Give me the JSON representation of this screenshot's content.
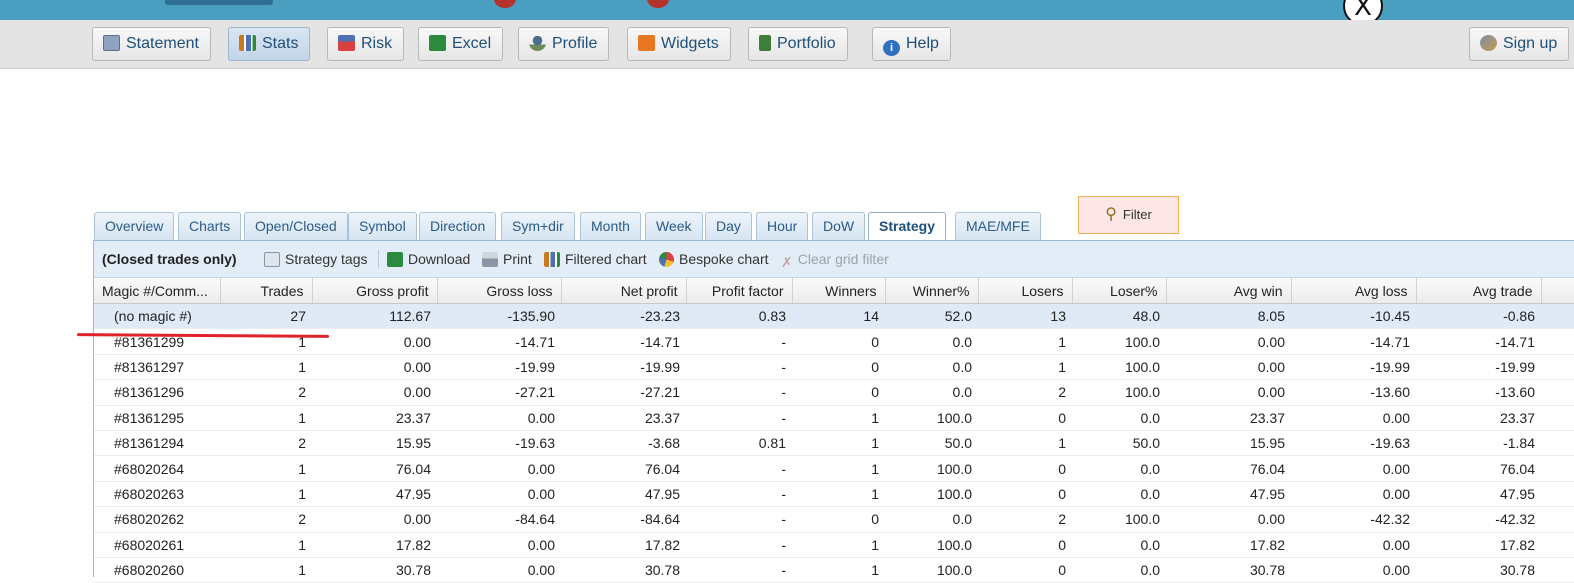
{
  "window": {
    "close_label": "X"
  },
  "nav": [
    {
      "label": "Statement",
      "icon": "statement-icon",
      "color": "#6f86a8"
    },
    {
      "label": "Stats",
      "icon": "stats-icon",
      "color": "#c77b1e",
      "active": true
    },
    {
      "label": "Risk",
      "icon": "risk-icon",
      "color": "#4d6fb3"
    },
    {
      "label": "Excel",
      "icon": "excel-icon",
      "color": "#2b8a3e"
    },
    {
      "label": "Profile",
      "icon": "profile-icon",
      "color": "#4a6f8f"
    },
    {
      "label": "Widgets",
      "icon": "rss-icon",
      "color": "#e87722"
    },
    {
      "label": "Portfolio",
      "icon": "portfolio-icon",
      "color": "#3f7d3a"
    },
    {
      "label": "Help",
      "icon": "info-icon",
      "color": "#2f6fc1"
    }
  ],
  "signup": {
    "label": "Sign up",
    "icon": "users-icon"
  },
  "tabs": [
    "Overview",
    "Charts",
    "Open/Closed",
    "Symbol",
    "Direction",
    "Sym+dir",
    "Month",
    "Week",
    "Day",
    "Hour",
    "DoW",
    "Strategy",
    "MAE/MFE"
  ],
  "active_tab": "Strategy",
  "filter": {
    "label": "Filter",
    "icon": "filter-icon"
  },
  "toolbar": {
    "scope": "(Closed trades only)",
    "strategy_tags": "Strategy tags",
    "download": "Download",
    "print": "Print",
    "filtered_chart": "Filtered chart",
    "bespoke_chart": "Bespoke chart",
    "clear_filter": "Clear grid filter"
  },
  "columns": [
    "Magic #/Comm...",
    "Trades",
    "Gross profit",
    "Gross loss",
    "Net profit",
    "Profit factor",
    "Winners",
    "Winner%",
    "Losers",
    "Loser%",
    "Avg win",
    "Avg loss",
    "Avg trade"
  ],
  "rows": [
    [
      "(no magic #)",
      "27",
      "112.67",
      "-135.90",
      "-23.23",
      "0.83",
      "14",
      "52.0",
      "13",
      "48.0",
      "8.05",
      "-10.45",
      "-0.86"
    ],
    [
      "#81361299",
      "1",
      "0.00",
      "-14.71",
      "-14.71",
      "-",
      "0",
      "0.0",
      "1",
      "100.0",
      "0.00",
      "-14.71",
      "-14.71"
    ],
    [
      "#81361297",
      "1",
      "0.00",
      "-19.99",
      "-19.99",
      "-",
      "0",
      "0.0",
      "1",
      "100.0",
      "0.00",
      "-19.99",
      "-19.99"
    ],
    [
      "#81361296",
      "2",
      "0.00",
      "-27.21",
      "-27.21",
      "-",
      "0",
      "0.0",
      "2",
      "100.0",
      "0.00",
      "-13.60",
      "-13.60"
    ],
    [
      "#81361295",
      "1",
      "23.37",
      "0.00",
      "23.37",
      "-",
      "1",
      "100.0",
      "0",
      "0.0",
      "23.37",
      "0.00",
      "23.37"
    ],
    [
      "#81361294",
      "2",
      "15.95",
      "-19.63",
      "-3.68",
      "0.81",
      "1",
      "50.0",
      "1",
      "50.0",
      "15.95",
      "-19.63",
      "-1.84"
    ],
    [
      "#68020264",
      "1",
      "76.04",
      "0.00",
      "76.04",
      "-",
      "1",
      "100.0",
      "0",
      "0.0",
      "76.04",
      "0.00",
      "76.04"
    ],
    [
      "#68020263",
      "1",
      "47.95",
      "0.00",
      "47.95",
      "-",
      "1",
      "100.0",
      "0",
      "0.0",
      "47.95",
      "0.00",
      "47.95"
    ],
    [
      "#68020262",
      "2",
      "0.00",
      "-84.64",
      "-84.64",
      "-",
      "0",
      "0.0",
      "2",
      "100.0",
      "0.00",
      "-42.32",
      "-42.32"
    ],
    [
      "#68020261",
      "1",
      "17.82",
      "0.00",
      "17.82",
      "-",
      "1",
      "100.0",
      "0",
      "0.0",
      "17.82",
      "0.00",
      "17.82"
    ],
    [
      "#68020260",
      "1",
      "30.78",
      "0.00",
      "30.78",
      "-",
      "1",
      "100.0",
      "0",
      "0.0",
      "30.78",
      "0.00",
      "30.78"
    ]
  ],
  "colors": {
    "topbar": "#4a9fc0",
    "annotation": "#e0232a",
    "summary_row": "#dfeaf6"
  }
}
